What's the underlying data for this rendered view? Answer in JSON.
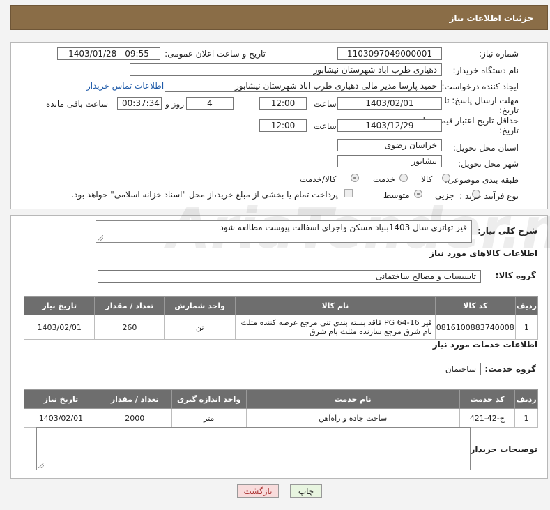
{
  "header": {
    "title": "جزئیات اطلاعات نیاز"
  },
  "form": {
    "need_number_label": "شماره نیاز:",
    "need_number": "1103097049000001",
    "announce_label": "تاریخ و ساعت اعلان عمومی:",
    "announce_value": "1403/01/28 - 09:55",
    "buyer_org_label": "نام دستگاه خریدار:",
    "buyer_org": "دهیاری طرب اباد شهرستان نیشابور",
    "requester_label": "ایجاد کننده درخواست:",
    "requester": "حمید پارسا مدیر مالی دهیاری طرب اباد شهرستان نیشابور",
    "buyer_contact_link": "اطلاعات تماس خریدار",
    "send_deadline_label_1": "مهلت ارسال پاسخ: تا",
    "send_deadline_label_2": "تاریخ:",
    "send_date": "1403/02/01",
    "time_label": "ساعت",
    "send_time": "12:00",
    "days": "4",
    "day_and_label": "روز و",
    "remaining_time": "00:37:34",
    "remaining_label": "ساعت باقی مانده",
    "validity_label_1": "حداقل تاریخ اعتبار قیمت: تا",
    "validity_label_2": "تاریخ:",
    "validity_date": "1403/12/29",
    "validity_time_label": "ساعت",
    "validity_time": "12:00",
    "province_label": "استان محل تحویل:",
    "province": "خراسان رضوی",
    "city_label": "شهر محل تحویل:",
    "city": "نیشابور",
    "category_label": "طبقه بندی موضوعی:",
    "category_options": [
      "کالا",
      "خدمت",
      "کالا/خدمت"
    ],
    "purchase_type_label": "نوع فرآیند خرید :",
    "purchase_options": [
      "جزیی",
      "متوسط"
    ],
    "payment_note": "پرداخت تمام یا بخشی از مبلغ خرید،از محل \"اسناد خزانه اسلامی\" خواهد بود."
  },
  "description": {
    "label": "شرح کلی نیاز:",
    "text": "قیر تهاتری سال 1403بنیاد مسکن واجرای اسفالت پیوست مطالعه شود"
  },
  "goods": {
    "section_title": "اطلاعات کالاهای مورد نیاز",
    "group_label": "گروه کالا:",
    "group_value": "تاسیسات و مصالح ساختمانی",
    "headers": [
      "ردیف",
      "کد کالا",
      "نام کالا",
      "واحد شمارش",
      "تعداد / مقدار",
      "تاریخ نیاز"
    ],
    "rows": [
      {
        "row": "1",
        "code": "0816100883740008",
        "name": "قیر PG 64-16 فاقد بسته بندی تنی مرجع عرضه کننده مثلث بام شرق مرجع سازنده مثلث بام شرق",
        "unit": "تن",
        "qty": "260",
        "date": "1403/02/01"
      }
    ]
  },
  "services": {
    "section_title": "اطلاعات خدمات مورد نیاز",
    "group_label": "گروه خدمت:",
    "group_value": "ساختمان",
    "headers": [
      "ردیف",
      "کد خدمت",
      "نام خدمت",
      "واحد اندازه گیری",
      "تعداد / مقدار",
      "تاریخ نیاز"
    ],
    "rows": [
      {
        "row": "1",
        "code": "ج-42-421",
        "name": "ساخت جاده و راه‌آهن",
        "unit": "متر",
        "qty": "2000",
        "date": "1403/02/01"
      }
    ]
  },
  "buyer_notes": {
    "label": "توضیحات خریدار:",
    "text": ""
  },
  "buttons": {
    "print": "چاپ",
    "back": "بازگشت"
  },
  "watermark": "AriaTender.neT"
}
